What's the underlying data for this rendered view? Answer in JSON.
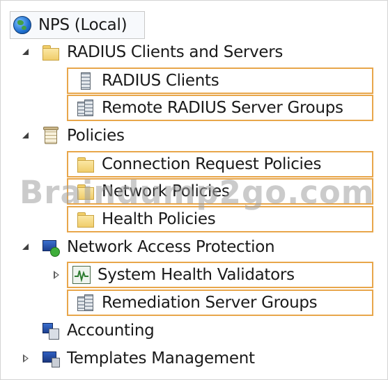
{
  "tree": {
    "root": {
      "label": "NPS (Local)",
      "icon": "globe-icon"
    },
    "nodes": [
      {
        "label": "RADIUS Clients and Servers",
        "icon": "folder-icon",
        "expander": "expanded"
      },
      {
        "label": "RADIUS Clients",
        "icon": "server-icon"
      },
      {
        "label": "Remote RADIUS Server Groups",
        "icon": "server-group-icon"
      },
      {
        "label": "Policies",
        "icon": "policy-icon",
        "expander": "expanded"
      },
      {
        "label": "Connection Request Policies",
        "icon": "folder-icon"
      },
      {
        "label": "Network Policies",
        "icon": "folder-icon"
      },
      {
        "label": "Health Policies",
        "icon": "folder-icon"
      },
      {
        "label": "Network Access Protection",
        "icon": "nap-icon",
        "expander": "expanded"
      },
      {
        "label": "System Health Validators",
        "icon": "health-monitor-icon",
        "expander": "collapsed"
      },
      {
        "label": "Remediation Server Groups",
        "icon": "server-group-icon"
      },
      {
        "label": "Accounting",
        "icon": "accounting-icon"
      },
      {
        "label": "Templates Management",
        "icon": "templates-icon",
        "expander": "collapsed"
      }
    ]
  },
  "watermark": "Braindump2go.com",
  "colors": {
    "highlight_border": "#e8a64a",
    "watermark": "#a0a0a0"
  }
}
